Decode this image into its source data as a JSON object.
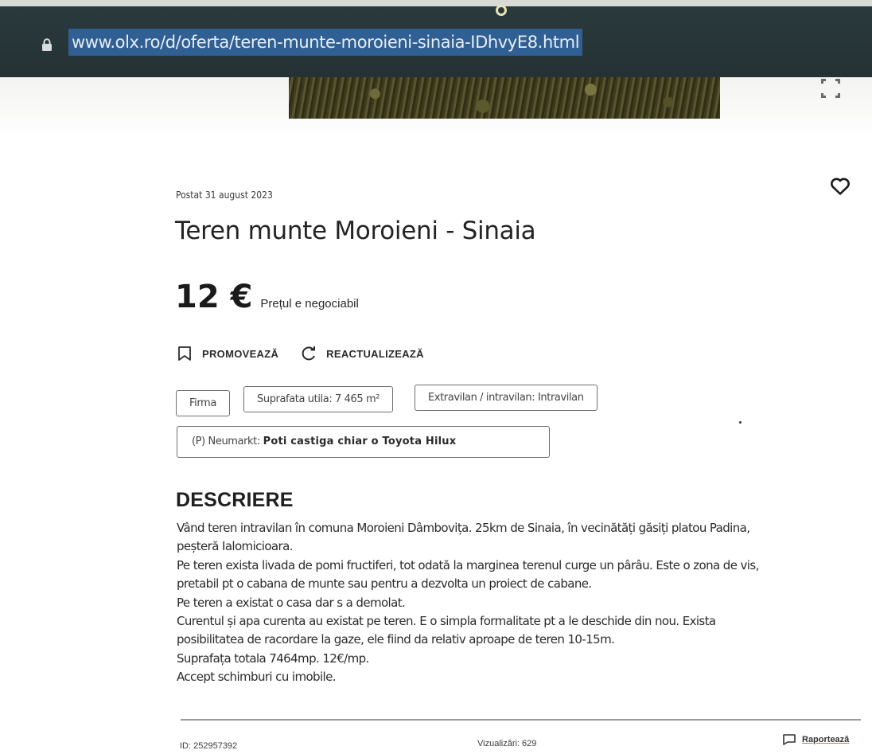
{
  "browser": {
    "url": "www.olx.ro/d/oferta/teren-munte-moroieni-sinaia-IDhvyE8.html"
  },
  "listing": {
    "posted": "Postat 31 august 2023",
    "title": "Teren munte Moroieni - Sinaia",
    "price": "12 €",
    "price_note": "Prețul e negociabil",
    "actions": {
      "promote": "PROMOVEAZĂ",
      "refresh": "REACTUALIZEAZĂ"
    },
    "tags": [
      "Firma",
      "Suprafata utila: 7 465 m²",
      "Extravilan / intravilan: Intravilan"
    ],
    "promo": {
      "prefix": "(P) Neumarkt:",
      "text": "Poti castiga chiar o Toyota Hilux"
    }
  },
  "description": {
    "heading": "DESCRIERE",
    "lines": [
      "Vând teren intravilan în comuna Moroieni Dâmbovița. 25km de Sinaia, în vecinătăți găsiți platou Padina,",
      "peșteră Ialomicioara.",
      "Pe teren exista livada de pomi fructiferi, tot odată la marginea terenul curge un pârâu. Este o zona de vis,",
      "pretabil pt o cabana de munte sau pentru a dezvolta un proiect de cabane.",
      "Pe teren a existat o casa dar s a demolat.",
      "Curentul și apa curenta au existat pe teren. E o simpla formalitate pt a le deschide din nou. Exista",
      "posibilitatea de racordare la gaze, ele fiind da relativ aproape de teren 10-15m.",
      "Suprafața totala 7464mp. 12€/mp.",
      "Accept schimburi cu imobile."
    ]
  },
  "footer": {
    "id": "ID: 252957392",
    "views": "Vizualizări: 629",
    "report": "Raportează"
  },
  "icons": {
    "lock": "lock-icon",
    "fullscreen": "fullscreen-icon",
    "favorite": "heart-icon",
    "promote": "bookmark-icon",
    "refresh": "refresh-icon",
    "report": "flag-icon"
  }
}
